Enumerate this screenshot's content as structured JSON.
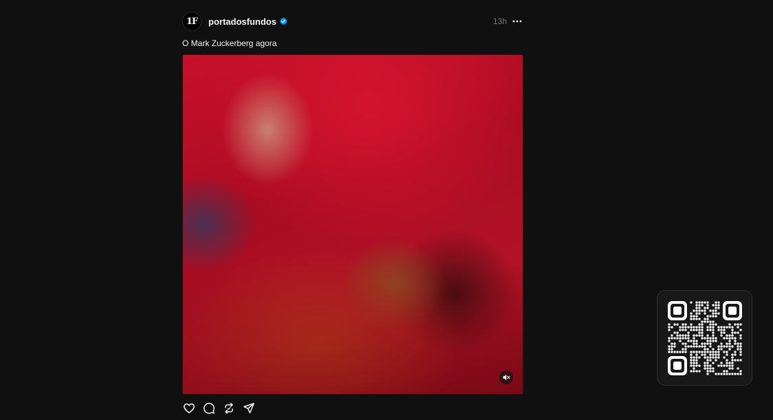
{
  "post": {
    "author": {
      "username": "portadosfundos",
      "avatar_text": "1F",
      "verified": true
    },
    "timestamp": "13h",
    "more_icon": "more-horizontal-icon",
    "caption": "O Mark Zuckerberg agora",
    "media": {
      "type": "video",
      "muted": true,
      "mute_icon": "speaker-muted-icon"
    },
    "actions": [
      {
        "name": "like",
        "icon": "heart-icon"
      },
      {
        "name": "reply",
        "icon": "comment-bubble-icon"
      },
      {
        "name": "repost",
        "icon": "repost-icon"
      },
      {
        "name": "share",
        "icon": "send-icon"
      }
    ]
  },
  "qr_code": {
    "icon": "qr-code-icon"
  },
  "colors": {
    "background": "#101010",
    "text_primary": "#f3f5f7",
    "text_secondary": "#777777",
    "verified_badge": "#0095f6"
  }
}
